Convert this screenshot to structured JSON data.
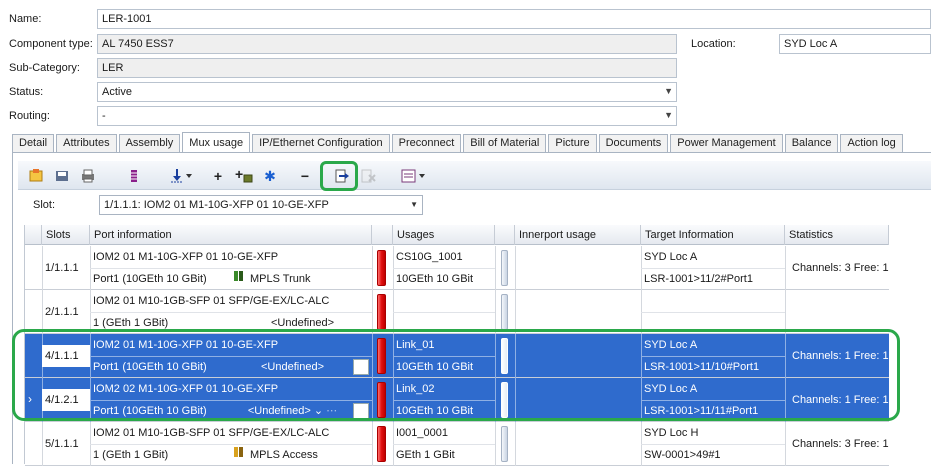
{
  "form": {
    "name_label": "Name:",
    "name_value": "LER-1001",
    "component_type_label": "Component type:",
    "component_type_value": "AL 7450 ESS7",
    "location_label": "Location:",
    "location_value": "SYD Loc A",
    "subcategory_label": "Sub-Category:",
    "subcategory_value": "LER",
    "status_label": "Status:",
    "status_value": "Active",
    "routing_label": "Routing:",
    "routing_value": "-"
  },
  "tabs": [
    {
      "label": "Detail"
    },
    {
      "label": "Attributes"
    },
    {
      "label": "Assembly"
    },
    {
      "label": "Mux usage",
      "active": true
    },
    {
      "label": "IP/Ethernet Configuration"
    },
    {
      "label": "Preconnect"
    },
    {
      "label": "Bill of Material"
    },
    {
      "label": "Picture"
    },
    {
      "label": "Documents"
    },
    {
      "label": "Power Management"
    },
    {
      "label": "Balance"
    },
    {
      "label": "Action log"
    }
  ],
  "toolbar": {
    "add_glyph": "+",
    "remove_glyph": "−",
    "asterisk_glyph": "✱",
    "icons": [
      "new-icon",
      "save-icon",
      "print-icon",
      "columns-icon",
      "sort-icon",
      "add-icon",
      "add-item-icon",
      "star-icon",
      "remove-icon",
      "assign-icon",
      "delete-icon",
      "export-icon"
    ]
  },
  "slot": {
    "label": "Slot:",
    "value": "1/1.1.1: IOM2 01 M1-10G-XFP 01 10-GE-XFP"
  },
  "grid": {
    "headers": {
      "slots": "Slots",
      "port": "Port information",
      "usages": "Usages",
      "innerport": "Innerport usage",
      "target": "Target Information",
      "stats": "Statistics"
    },
    "rows": [
      {
        "slot": "1/1.1.1",
        "card": "IOM2 01 M1-10G-XFP 01 10-GE-XFP",
        "port": "Port1 (10GEth 10 GBit)",
        "service": "MPLS Trunk",
        "usage": "CS10G_1001",
        "usage_detail": "10GEth 10 GBit",
        "target_loc": "SYD Loc A",
        "target_port": "LSR-1001>11/2#Port1",
        "stats": "Channels: 3 Free: 1"
      },
      {
        "slot": "2/1.1.1",
        "card": "IOM2 01 M10-1GB-SFP 01 SFP/GE-EX/LC-ALC",
        "port": "1 (GEth 1 GBit)",
        "service": "<Undefined>",
        "usage": "",
        "usage_detail": "",
        "target_loc": "",
        "target_port": "",
        "stats": ""
      },
      {
        "slot": "4/1.1.1",
        "card": "IOM2 01 M1-10G-XFP 01 10-GE-XFP",
        "port": "Port1 (10GEth 10 GBit)",
        "service": "<Undefined>",
        "usage": "Link_01",
        "usage_detail": "10GEth 10 GBit",
        "target_loc": "SYD Loc A",
        "target_port": "LSR-1001>11/10#Port1",
        "stats": "Channels: 1 Free: 1"
      },
      {
        "slot": "4/1.2.1",
        "card": "IOM2 02 M1-10G-XFP 01 10-GE-XFP",
        "port": "Port1 (10GEth 10 GBit)",
        "service": "<Undefined>",
        "usage": "Link_02",
        "usage_detail": "10GEth 10 GBit",
        "target_loc": "SYD Loc A",
        "target_port": "LSR-1001>11/11#Port1",
        "stats": "Channels: 1 Free: 1"
      },
      {
        "slot": "5/1.1.1",
        "card": "IOM2 01 M10-1GB-SFP 01 SFP/GE-EX/LC-ALC",
        "port": "1 (GEth 1 GBit)",
        "service": "MPLS Access",
        "usage": "I001_0001",
        "usage_detail": "GEth 1 GBit",
        "target_loc": "SYD Loc H",
        "target_port": "SW-0001>49#1",
        "stats": "Channels: 3 Free: 1"
      }
    ]
  },
  "colors": {
    "selection": "#2f6bcd",
    "highlight": "#2aa84a",
    "usage_bar": "#e01010"
  }
}
